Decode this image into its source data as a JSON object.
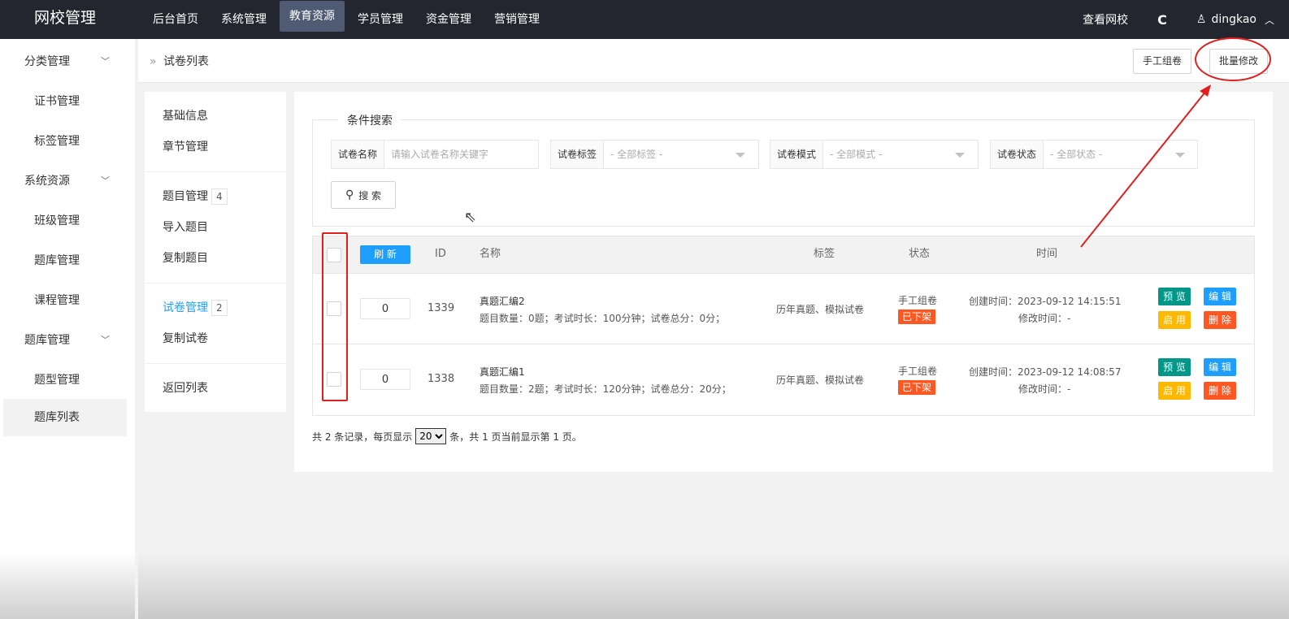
{
  "topbar": {
    "brand": "网校管理",
    "nav": [
      "后台首页",
      "系统管理",
      "教育资源",
      "学员管理",
      "资金管理",
      "营销管理"
    ],
    "active_nav": "教育资源",
    "view_site": "查看网校",
    "username": "dingkao"
  },
  "sidebar": {
    "groups": [
      {
        "label": "分类管理",
        "items": [
          "证书管理",
          "标签管理"
        ]
      },
      {
        "label": "系统资源",
        "items": [
          "班级管理",
          "题库管理",
          "课程管理"
        ]
      },
      {
        "label": "题库管理",
        "items": [
          "题型管理",
          "题库列表"
        ]
      }
    ],
    "active_item": "题库列表"
  },
  "breadcrumb": {
    "sep": "»",
    "label": "试卷列表"
  },
  "header_buttons": {
    "manual": "手工组卷",
    "batch": "批量修改"
  },
  "innermenu": {
    "basic": "基础信息",
    "chapter": "章节管理",
    "question_mgmt": "题目管理",
    "question_count": "4",
    "import_q": "导入题目",
    "copy_q": "复制题目",
    "paper_mgmt": "试卷管理",
    "paper_count": "2",
    "copy_paper": "复制试卷",
    "back": "返回列表"
  },
  "search": {
    "legend": "条件搜索",
    "name_label": "试卷名称",
    "name_placeholder": "请输入试卷名称关键字",
    "tag_label": "试卷标签",
    "tag_value": "- 全部标签 -",
    "mode_label": "试卷模式",
    "mode_value": "- 全部模式 -",
    "status_label": "试卷状态",
    "status_value": "- 全部状态 -",
    "button": "搜 索"
  },
  "table": {
    "refresh": "刷 新",
    "headers": {
      "id": "ID",
      "name": "名称",
      "tag": "标签",
      "status": "状态",
      "time": "时间"
    },
    "rows": [
      {
        "sort": "0",
        "id": "1339",
        "title": "真题汇编2",
        "meta": "题目数量：0题；考试时长：100分钟；试卷总分：0分；",
        "tags": "历年真题、模拟试卷",
        "mode": "手工组卷",
        "state": "已下架",
        "created": "创建时间：2023-09-12 14:15:51",
        "modified": "修改时间：-"
      },
      {
        "sort": "0",
        "id": "1338",
        "title": "真题汇编1",
        "meta": "题目数量：2题；考试时长：120分钟；试卷总分：20分；",
        "tags": "历年真题、模拟试卷",
        "mode": "手工组卷",
        "state": "已下架",
        "created": "创建时间：2023-09-12 14:08:57",
        "modified": "修改时间：-"
      }
    ],
    "actions": {
      "preview": "预 览",
      "edit": "编 辑",
      "enable": "启 用",
      "delete": "删 除"
    }
  },
  "pager": {
    "prefix": "共 2 条记录，每页显示",
    "page_size": "20",
    "suffix": "条，共 1 页当前显示第 1 页。"
  },
  "colors": {
    "topbar": "#23262e",
    "accent": "#1e9fff",
    "annotation": "#e0201e"
  }
}
